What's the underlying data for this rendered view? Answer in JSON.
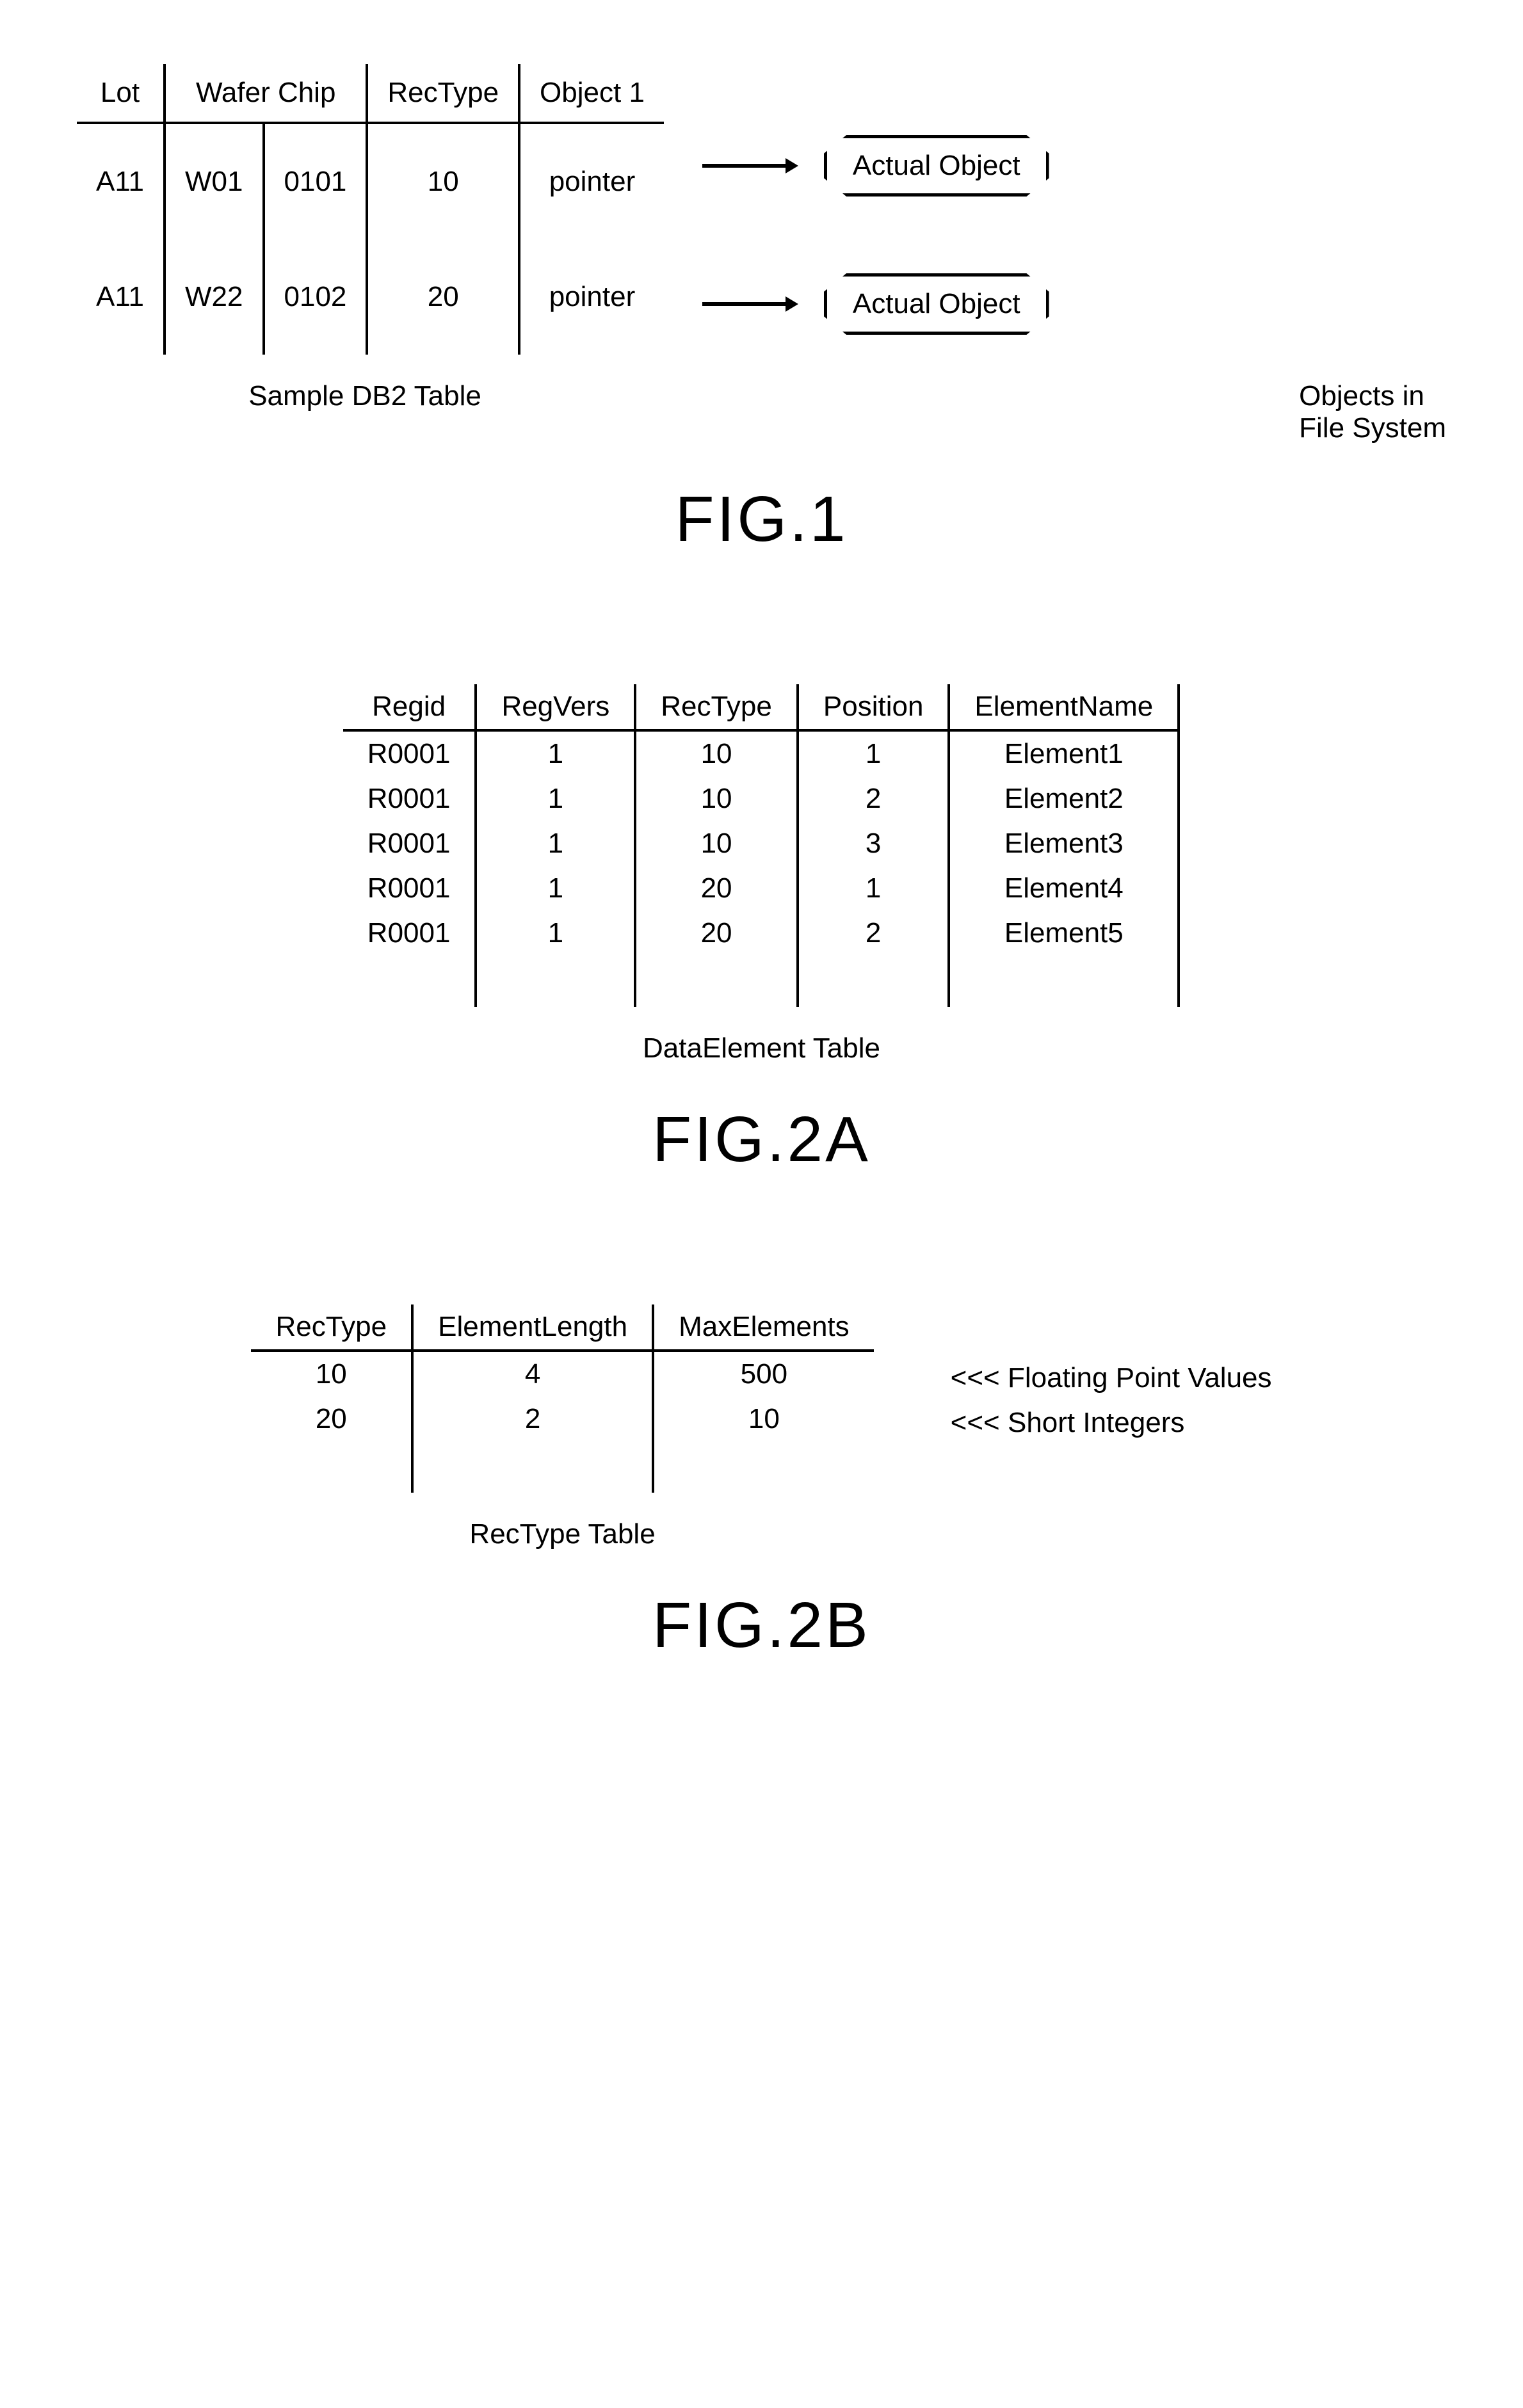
{
  "fig1": {
    "headers": {
      "lot": "Lot",
      "wafer_chip": "Wafer  Chip",
      "rectype": "RecType",
      "object1": "Object 1"
    },
    "rows": [
      {
        "lot": "A11",
        "wafer": "W01",
        "chip": "0101",
        "rectype": "10",
        "object": "pointer",
        "target": "Actual Object"
      },
      {
        "lot": "A11",
        "wafer": "W22",
        "chip": "0102",
        "rectype": "20",
        "object": "pointer",
        "target": "Actual Object"
      }
    ],
    "caption_left": "Sample DB2 Table",
    "caption_right": "Objects in\nFile System",
    "title": "FIG.1"
  },
  "fig2a": {
    "headers": [
      "Regid",
      "RegVers",
      "RecType",
      "Position",
      "ElementName"
    ],
    "rows": [
      [
        "R0001",
        "1",
        "10",
        "1",
        "Element1"
      ],
      [
        "R0001",
        "1",
        "10",
        "2",
        "Element2"
      ],
      [
        "R0001",
        "1",
        "10",
        "3",
        "Element3"
      ],
      [
        "R0001",
        "1",
        "20",
        "1",
        "Element4"
      ],
      [
        "R0001",
        "1",
        "20",
        "2",
        "Element5"
      ]
    ],
    "caption": "DataElement Table",
    "title": "FIG.2A"
  },
  "fig2b": {
    "headers": [
      "RecType",
      "ElementLength",
      "MaxElements"
    ],
    "rows": [
      [
        "10",
        "4",
        "500"
      ],
      [
        "20",
        "2",
        "10"
      ]
    ],
    "notes": [
      "<<< Floating Point Values",
      "<<< Short Integers"
    ],
    "caption": "RecType Table",
    "title": "FIG.2B"
  },
  "chart_data": [
    {
      "type": "table",
      "name": "Sample DB2 Table",
      "columns": [
        "Lot",
        "Wafer",
        "Chip",
        "RecType",
        "Object 1"
      ],
      "rows": [
        [
          "A11",
          "W01",
          "0101",
          10,
          "pointer → Actual Object"
        ],
        [
          "A11",
          "W22",
          "0102",
          20,
          "pointer → Actual Object"
        ]
      ]
    },
    {
      "type": "table",
      "name": "DataElement Table",
      "columns": [
        "Regid",
        "RegVers",
        "RecType",
        "Position",
        "ElementName"
      ],
      "rows": [
        [
          "R0001",
          1,
          10,
          1,
          "Element1"
        ],
        [
          "R0001",
          1,
          10,
          2,
          "Element2"
        ],
        [
          "R0001",
          1,
          10,
          3,
          "Element3"
        ],
        [
          "R0001",
          1,
          20,
          1,
          "Element4"
        ],
        [
          "R0001",
          1,
          20,
          2,
          "Element5"
        ]
      ]
    },
    {
      "type": "table",
      "name": "RecType Table",
      "columns": [
        "RecType",
        "ElementLength",
        "MaxElements"
      ],
      "rows": [
        [
          10,
          4,
          500
        ],
        [
          20,
          2,
          10
        ]
      ],
      "row_annotations": [
        "Floating Point Values",
        "Short Integers"
      ]
    }
  ]
}
